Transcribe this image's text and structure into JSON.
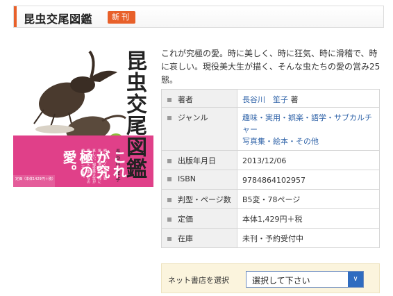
{
  "header": {
    "title": "昆虫交尾図鑑",
    "badge": "新刊"
  },
  "cover": {
    "title": "昆虫交尾図鑑",
    "author": "長谷川 笙子",
    "catch": "これが究極の愛。",
    "blurb": "時に美しく、時に狂気、時に滑稽で、時に哀しい。現役美大生が描く、そんな虫たちの愛の営み二十五態。",
    "price_note": "定価（本体1429円＋税）"
  },
  "description": "これが究極の愛。時に美しく、時に狂気、時に滑稽で、時に哀しい。現役美大生が描く、そんな虫たちの愛の営み25態。",
  "spec": {
    "author_label": "著者",
    "author_value": "長谷川　笙子",
    "author_suffix": "著",
    "genre_label": "ジャンル",
    "genre_line1": "趣味・実用・娯楽・語学・サブカルチャー",
    "genre_line2": "写真集・絵本・その他",
    "date_label": "出版年月日",
    "date_value": "2013/12/06",
    "isbn_label": "ISBN",
    "isbn_value": "9784864102957",
    "format_label": "判型・ページ数",
    "format_value": "B5変・78ページ",
    "price_label": "定価",
    "price_value": "本体1,429円＋税",
    "stock_label": "在庫",
    "stock_value": "未刊・予約受付中"
  },
  "store": {
    "label": "ネット書店を選択",
    "selected": "選択して下さい"
  },
  "icons": {
    "dropdown": "chevron-down-icon"
  },
  "colors": {
    "accent": "#e8602a",
    "link": "#3366aa",
    "cover_pink": "#e04089",
    "select_button": "#2f6cc0"
  }
}
